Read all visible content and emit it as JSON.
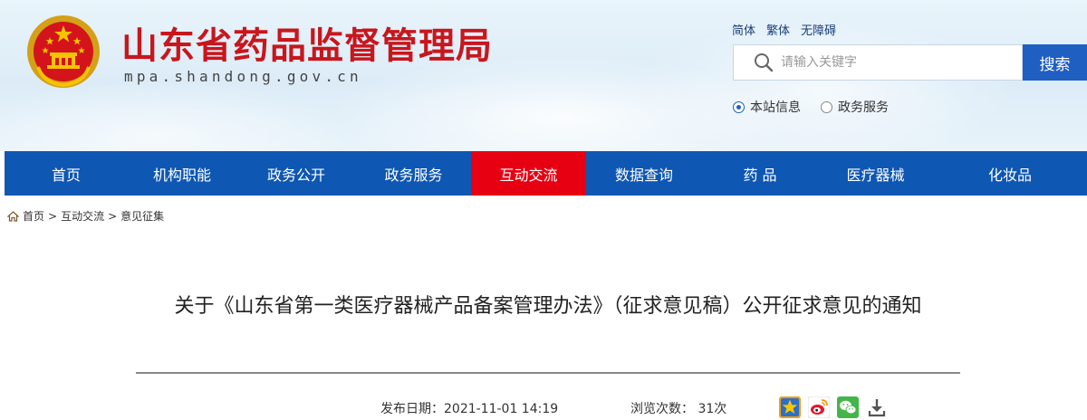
{
  "site": {
    "title": "山东省药品监督管理局",
    "domain": "mpa.shandong.gov.cn"
  },
  "lang_links": [
    "简体",
    "繁体",
    "无障碍"
  ],
  "search": {
    "placeholder": "请输入关键字",
    "button_label": "搜索",
    "scopes": [
      {
        "label": "本站信息",
        "checked": true
      },
      {
        "label": "政务服务",
        "checked": false
      }
    ]
  },
  "nav": {
    "items": [
      "首页",
      "机构职能",
      "政务公开",
      "政务服务",
      "互动交流",
      "数据查询",
      "药 品",
      "医疗器械",
      "化妆品"
    ],
    "active_index": 4
  },
  "breadcrumb": {
    "items": [
      "首页",
      "互动交流",
      "意见征集"
    ],
    "separator": ">"
  },
  "article": {
    "title": "关于《山东省第一类医疗器械产品备案管理办法》（征求意见稿）公开征求意见的通知",
    "publish_label": "发布日期：",
    "publish_date": "2021-11-01 14:19",
    "views_label": "浏览次数：",
    "views": "31次"
  },
  "share_icons": [
    "favorite-star-icon",
    "weibo-icon",
    "wechat-icon",
    "download-icon"
  ],
  "colors": {
    "title_red": "#c8161d",
    "nav_blue": "#0e57b3",
    "nav_active_red": "#e60012",
    "search_blue": "#1f5fc2"
  }
}
